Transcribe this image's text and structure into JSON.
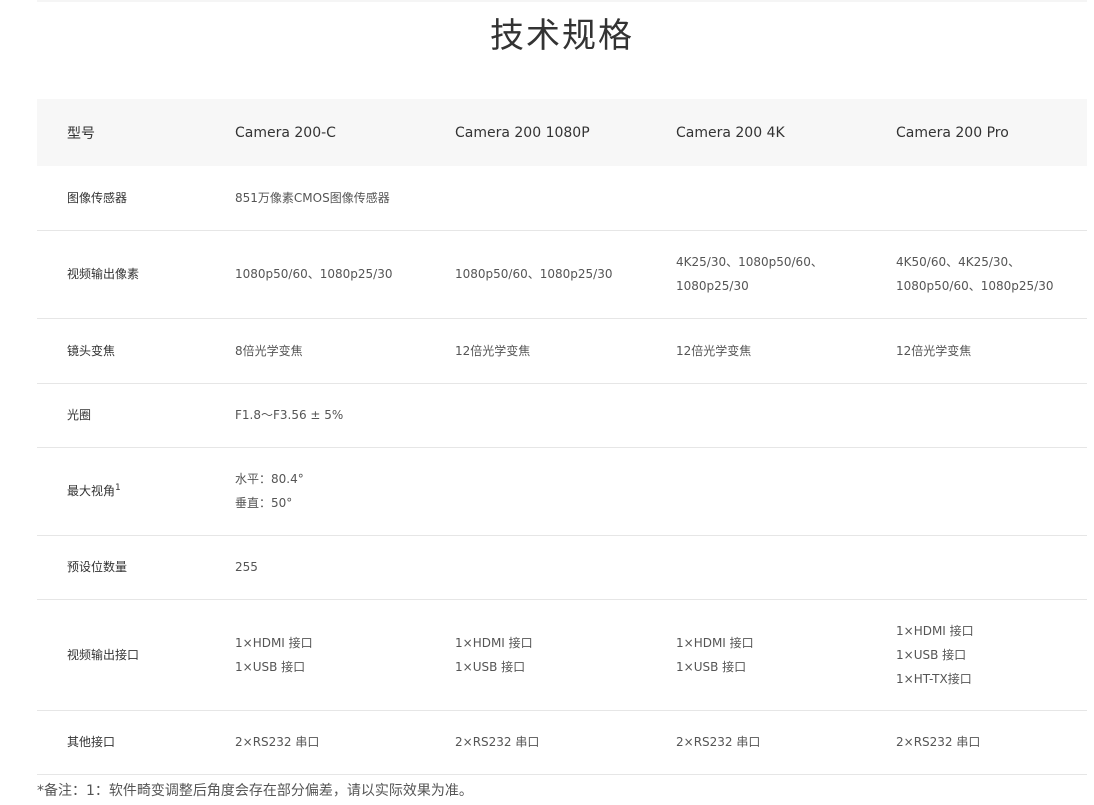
{
  "title": "技术规格",
  "header": {
    "label": "型号",
    "models": [
      "Camera 200-C",
      "Camera 200 1080P",
      "Camera 200 4K",
      "Camera 200 Pro"
    ]
  },
  "rows": {
    "sensor": {
      "label": "图像传感器",
      "value": "851万像素CMOS图像传感器"
    },
    "resolution": {
      "label": "视频输出像素",
      "c200c": "1080p50/60、1080p25/30",
      "c1080p": "1080p50/60、1080p25/30",
      "c4k": [
        "4K25/30、1080p50/60、",
        "1080p25/30"
      ],
      "cpro": [
        "4K50/60、4K25/30、",
        "1080p50/60、1080p25/30"
      ]
    },
    "zoom": {
      "label": "镜头变焦",
      "c200c": "8倍光学变焦",
      "c1080p": "12倍光学变焦",
      "c4k": "12倍光学变焦",
      "cpro": "12倍光学变焦"
    },
    "aperture": {
      "label": "光圈",
      "value": "F1.8～F3.56 ± 5%"
    },
    "fov": {
      "label": "最大视角",
      "sup": "1",
      "horizontal": "水平：80.4°",
      "vertical": "垂直：50°"
    },
    "presets": {
      "label": "预设位数量",
      "value": "255"
    },
    "video_ports": {
      "label": "视频输出接口",
      "c200c": [
        "1×HDMI 接口",
        "1×USB 接口"
      ],
      "c1080p": [
        "1×HDMI 接口",
        "1×USB 接口"
      ],
      "c4k": [
        "1×HDMI 接口",
        "1×USB 接口"
      ],
      "cpro": [
        "1×HDMI 接口",
        "1×USB 接口",
        "1×HT-TX接口"
      ]
    },
    "other_ports": {
      "label": "其他接口",
      "c200c": "2×RS232 串口",
      "c1080p": "2×RS232 串口",
      "c4k": "2×RS232 串口",
      "cpro": "2×RS232 串口"
    }
  },
  "footnote": "*备注：1：软件畸变调整后角度会存在部分偏差，请以实际效果为准。"
}
